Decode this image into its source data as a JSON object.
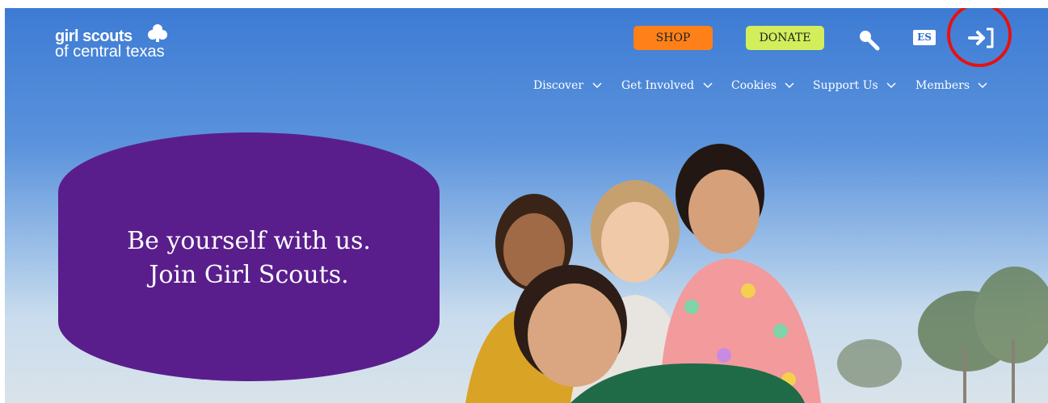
{
  "logo": {
    "brand": "girl scouts",
    "sub": "of central texas"
  },
  "header": {
    "shop_label": "SHOP",
    "donate_label": "DONATE",
    "lang_label": "ES",
    "icons": {
      "search": "search-icon",
      "login": "login-icon"
    }
  },
  "nav": {
    "items": [
      {
        "label": "Discover"
      },
      {
        "label": "Get Involved"
      },
      {
        "label": "Cookies"
      },
      {
        "label": "Support Us"
      },
      {
        "label": "Members"
      }
    ]
  },
  "hero": {
    "line1": "Be yourself with us.",
    "line2": "Join Girl Scouts."
  },
  "colors": {
    "sky_top": "#3d7bd4",
    "shop": "#ff8019",
    "donate": "#d2ee5b",
    "bubble": "#5a1e8c",
    "highlight": "#e81010"
  }
}
